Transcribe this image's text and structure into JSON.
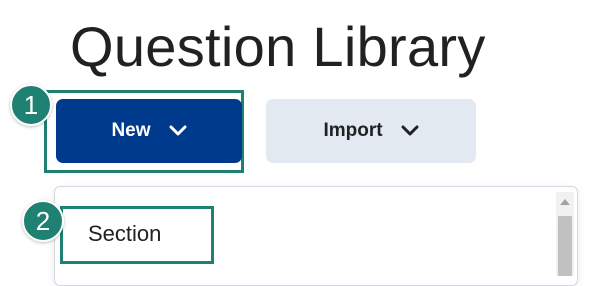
{
  "page": {
    "title": "Question Library"
  },
  "toolbar": {
    "new_label": "New",
    "import_label": "Import"
  },
  "dropdown": {
    "items": [
      {
        "label": "Section"
      }
    ]
  },
  "callouts": [
    {
      "number": "1"
    },
    {
      "number": "2"
    }
  ],
  "icons": {
    "new_button": "chevron-down-icon",
    "import_button": "chevron-down-icon",
    "scroll_up": "scroll-up-arrow-icon"
  },
  "colors": {
    "primary_button": "#003a8c",
    "secondary_button": "#e3e9f1",
    "callout": "#1f8172",
    "text": "#202122"
  }
}
